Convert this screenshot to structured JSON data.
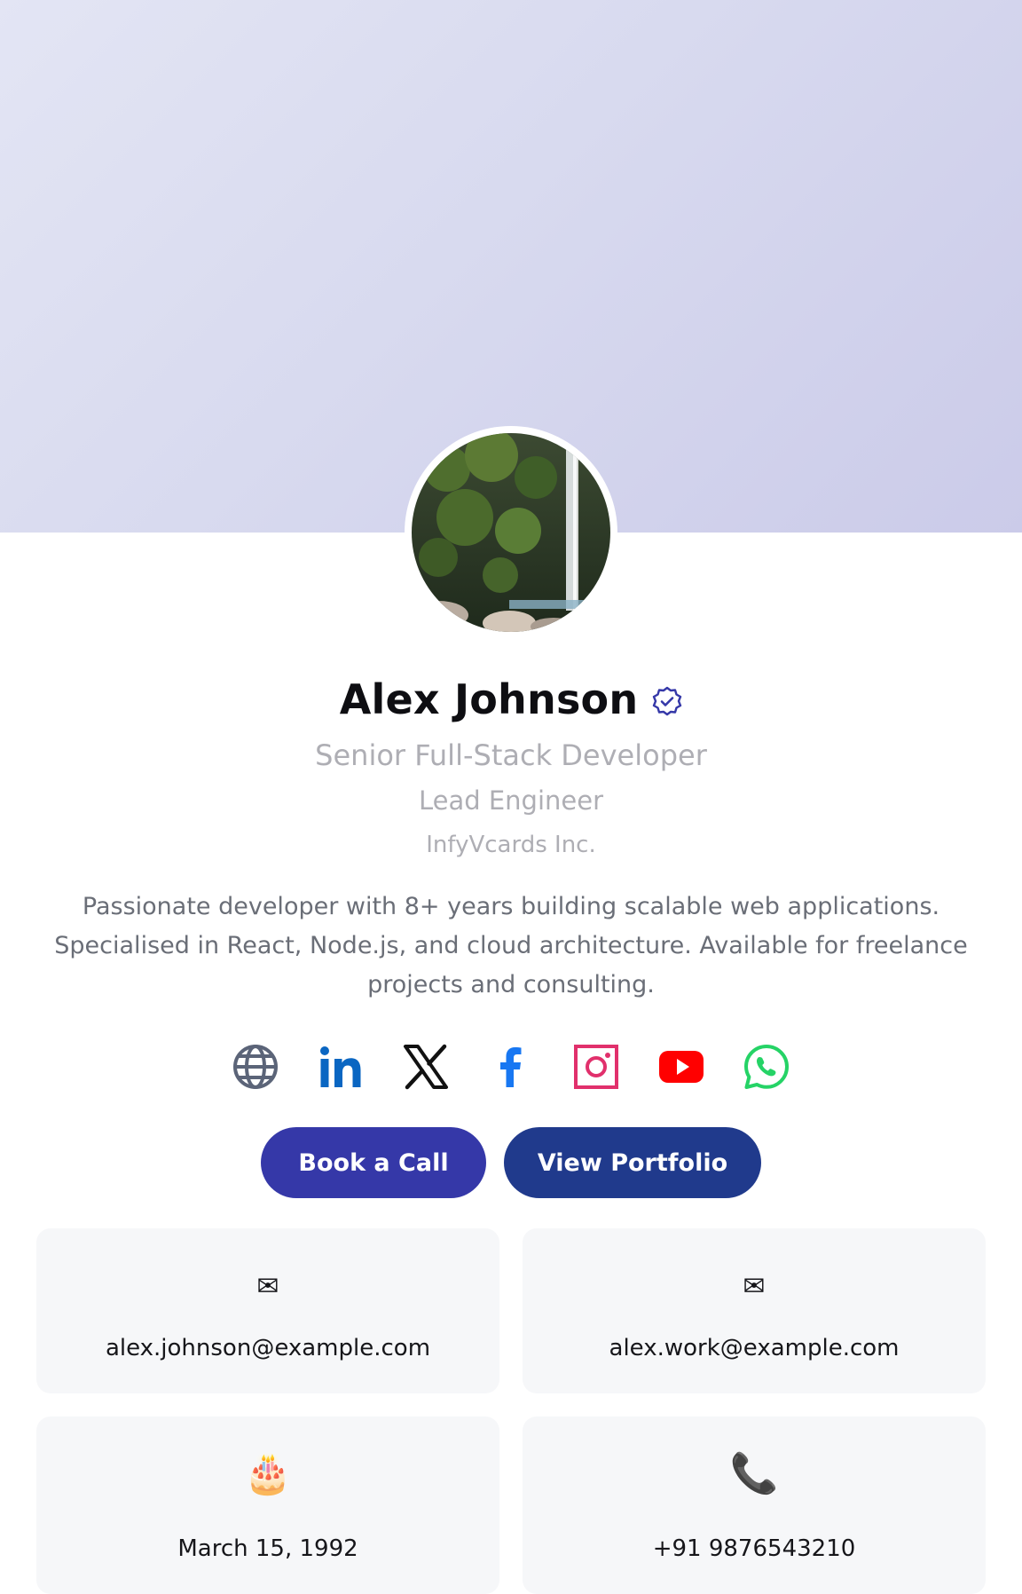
{
  "profile": {
    "name": "Alex Johnson",
    "title": "Senior Full-Stack Developer",
    "role": "Lead Engineer",
    "company": "InfyVcards Inc.",
    "bio": "Passionate developer with 8+ years building scalable web applications. Specialised in React, Node.js, and cloud architecture. Available for freelance projects and consulting.",
    "verified_icon": "verified-badge-icon"
  },
  "socials": [
    {
      "icon": "globe-icon",
      "color": "#5b6478"
    },
    {
      "icon": "linkedin-icon",
      "color": "#0a66c2"
    },
    {
      "icon": "x-twitter-icon",
      "color": "#111111"
    },
    {
      "icon": "facebook-icon",
      "color": "#1877f2"
    },
    {
      "icon": "instagram-icon",
      "color": "#e1306c"
    },
    {
      "icon": "youtube-icon",
      "color": "#ff0000"
    },
    {
      "icon": "whatsapp-icon",
      "color": "#25d366"
    }
  ],
  "buttons": {
    "book": "Book a Call",
    "portfolio": "View Portfolio"
  },
  "contacts": [
    {
      "icon": "✉",
      "text": "alex.johnson@example.com"
    },
    {
      "icon": "✉",
      "text": "alex.work@example.com"
    },
    {
      "icon": "🎂",
      "text": "March 15, 1992"
    },
    {
      "icon": "📞",
      "text": "+91 9876543210"
    }
  ],
  "colors": {
    "primary": "#3538a8",
    "secondary": "#203a8c",
    "verified": "#3538a8"
  }
}
